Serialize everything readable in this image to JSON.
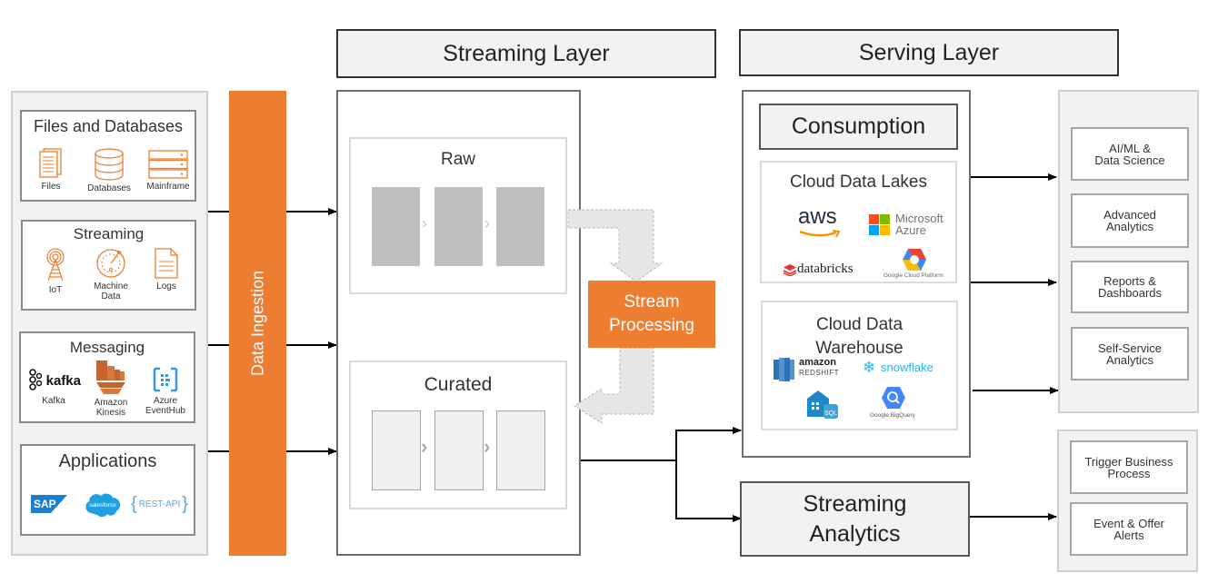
{
  "headers": {
    "streaming_layer": "Streaming Layer",
    "serving_layer": "Serving Layer"
  },
  "sources": {
    "files_and_databases": {
      "title": "Files and Databases",
      "items": [
        {
          "label": "Files",
          "icon": "files-icon"
        },
        {
          "label": "Databases",
          "icon": "database-icon"
        },
        {
          "label": "Mainframe",
          "icon": "mainframe-icon"
        }
      ]
    },
    "streaming": {
      "title": "Streaming",
      "items": [
        {
          "label": "IoT",
          "icon": "iot-antenna-icon"
        },
        {
          "label": "Machine Data",
          "label_line1": "Machine",
          "label_line2": "Data",
          "icon": "gauge-icon"
        },
        {
          "label": "Logs",
          "icon": "log-file-icon"
        }
      ]
    },
    "messaging": {
      "title": "Messaging",
      "items": [
        {
          "label": "Kafka",
          "logo_text": "kafka",
          "icon": "kafka-logo"
        },
        {
          "label": "Amazon Kinesis",
          "label_line1": "Amazon",
          "label_line2": "Kinesis",
          "icon": "kinesis-logo"
        },
        {
          "label": "Azure EventHub",
          "label_line1": "Azure",
          "label_line2": "EventHub",
          "icon": "eventhub-logo"
        }
      ]
    },
    "applications": {
      "title": "Applications",
      "items": [
        {
          "label": "SAP",
          "icon": "sap-logo"
        },
        {
          "label": "salesforce",
          "icon": "salesforce-logo"
        },
        {
          "label": "REST-API",
          "icon": "rest-api-logo"
        }
      ]
    }
  },
  "ingestion": {
    "label": "Data Ingestion"
  },
  "streaming_layer": {
    "raw": {
      "title": "Raw"
    },
    "curated": {
      "title": "Curated"
    },
    "processing": {
      "line1": "Stream",
      "line2": "Processing"
    }
  },
  "serving_layer": {
    "consumption": {
      "title": "Consumption"
    },
    "cloud_data_lakes": {
      "title": "Cloud Data Lakes",
      "logos": {
        "aws": "aws",
        "azure_line1": "Microsoft",
        "azure_line2": "Azure",
        "databricks": "databricks",
        "gcp": "Google Cloud Platform"
      }
    },
    "cloud_data_warehouse": {
      "title_line1": "Cloud Data",
      "title_line2": "Warehouse",
      "logos": {
        "redshift_line1": "amazon",
        "redshift_line2": "REDSHIFT",
        "snowflake": "snowflake",
        "sql_dw": "SQL",
        "bigquery": "Google BigQuery"
      }
    },
    "streaming_analytics": {
      "line1": "Streaming",
      "line2": "Analytics"
    }
  },
  "outputs": {
    "analytics": [
      {
        "line1": "AI/ML &",
        "line2": "Data Science"
      },
      {
        "line1": "Advanced",
        "line2": "Analytics"
      },
      {
        "line1": "Reports &",
        "line2": "Dashboards"
      },
      {
        "line1": "Self-Service",
        "line2": "Analytics"
      }
    ],
    "actions": [
      {
        "line1": "Trigger Business",
        "line2": "Process"
      },
      {
        "line1": "Event & Offer",
        "line2": "Alerts"
      }
    ]
  },
  "colors": {
    "accent_orange": "#ed7d31",
    "panel_gray": "#f2f2f2",
    "stage_gray": "#bfbfbf",
    "border_dark": "#333333"
  }
}
